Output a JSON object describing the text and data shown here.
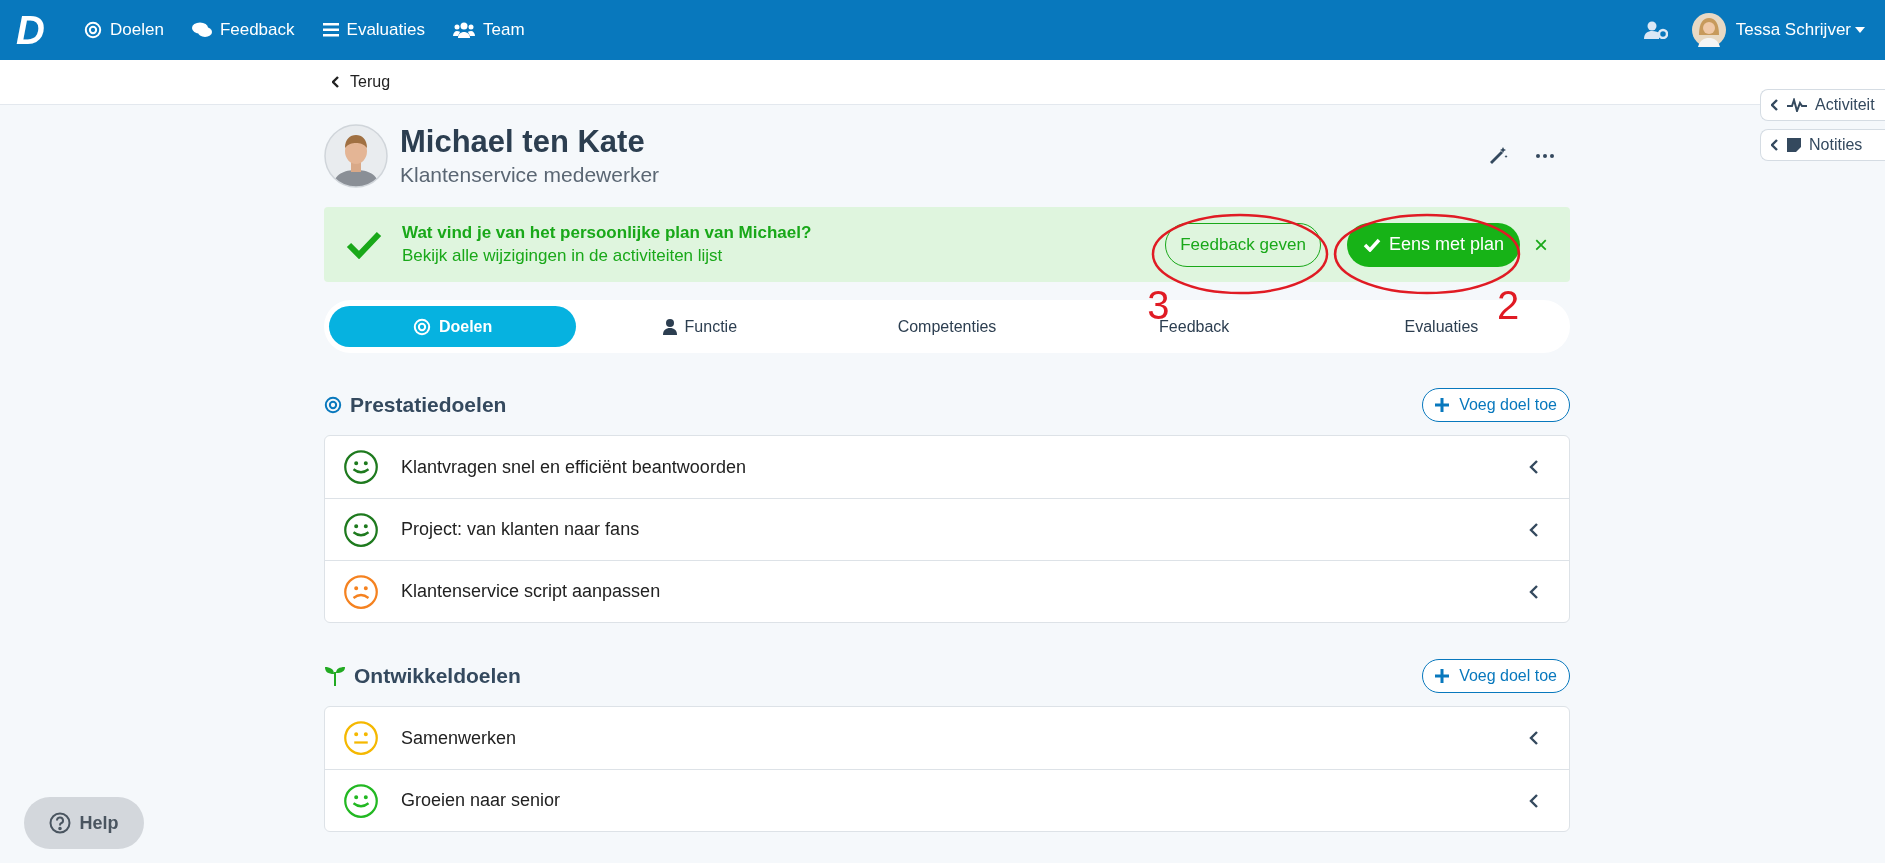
{
  "topbar": {
    "logo": "D",
    "nav": [
      {
        "label": "Doelen"
      },
      {
        "label": "Feedback"
      },
      {
        "label": "Evaluaties"
      },
      {
        "label": "Team"
      }
    ],
    "user": "Tessa Schrijver"
  },
  "back": "Terug",
  "side_panels": [
    {
      "label": "Activiteit"
    },
    {
      "label": "Notities"
    }
  ],
  "profile": {
    "name": "Michael ten Kate",
    "role": "Klantenservice medewerker"
  },
  "banner": {
    "question": "Wat vind je van het persoonlijke plan van Michael?",
    "link": "Bekijk alle wijzigingen in de activiteiten lijst",
    "secondary_button": "Feedback geven",
    "primary_button": "Eens met plan",
    "close": "×"
  },
  "annotations": [
    {
      "label": "3"
    },
    {
      "label": "2"
    }
  ],
  "tabs": [
    {
      "label": "Doelen",
      "selected": true
    },
    {
      "label": "Functie",
      "selected": false
    },
    {
      "label": "Competenties",
      "selected": false
    },
    {
      "label": "Feedback",
      "selected": false
    },
    {
      "label": "Evaluaties",
      "selected": false
    }
  ],
  "sections": [
    {
      "title": "Prestatiedoelen",
      "add_button": "Voeg doel toe",
      "items": [
        {
          "title": "Klantvragen snel en efficiënt beantwoorden",
          "kind": "happy",
          "color": "#1e7a1e"
        },
        {
          "title": "Project: van klanten naar fans",
          "kind": "happy",
          "color": "#1e7a1e"
        },
        {
          "title": "Klantenservice script aanpassen",
          "kind": "sad",
          "color": "#f58220"
        }
      ]
    },
    {
      "title": "Ontwikkeldoelen",
      "add_button": "Voeg doel toe",
      "items": [
        {
          "title": "Samenwerken",
          "kind": "neutral",
          "color": "#f5b800"
        },
        {
          "title": "Groeien naar senior",
          "kind": "happy",
          "color": "#22b822"
        }
      ]
    }
  ],
  "help": "Help"
}
